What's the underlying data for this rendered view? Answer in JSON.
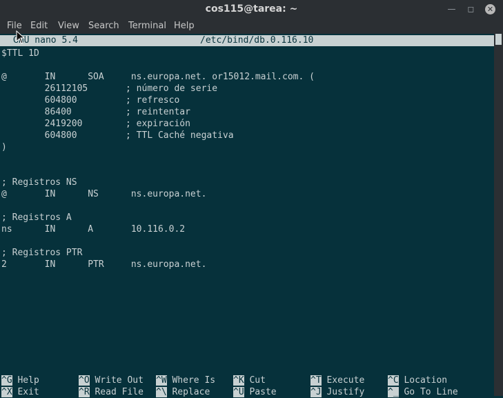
{
  "window": {
    "title": "cos115@tarea: ~"
  },
  "menu": {
    "file": "File",
    "edit": "Edit",
    "view": "View",
    "search": "Search",
    "terminal": "Terminal",
    "help": "Help"
  },
  "nano": {
    "version": "GNU nano 5.4",
    "filename": "/etc/bind/db.0.116.10"
  },
  "content": [
    "$TTL 1D",
    "",
    "@       IN      SOA     ns.europa.net. or15012.mail.com. (",
    "        26112105       ; número de serie",
    "        604800         ; refresco",
    "        86400          ; reintentar",
    "        2419200        ; expiración",
    "        604800         ; TTL Caché negativa",
    ")",
    "",
    "",
    "; Registros NS",
    "@       IN      NS      ns.europa.net.",
    "",
    "; Registros A",
    "ns      IN      A       10.116.0.2",
    "",
    "; Registros PTR",
    "2       IN      PTR     ns.europa.net."
  ],
  "shortcuts": [
    {
      "key": "^G",
      "label": "Help"
    },
    {
      "key": "^O",
      "label": "Write Out"
    },
    {
      "key": "^W",
      "label": "Where Is"
    },
    {
      "key": "^K",
      "label": "Cut"
    },
    {
      "key": "^T",
      "label": "Execute"
    },
    {
      "key": "^C",
      "label": "Location"
    },
    {
      "key": "^X",
      "label": "Exit"
    },
    {
      "key": "^R",
      "label": "Read File"
    },
    {
      "key": "^\\",
      "label": "Replace"
    },
    {
      "key": "^U",
      "label": "Paste"
    },
    {
      "key": "^J",
      "label": "Justify"
    },
    {
      "key": "^_",
      "label": "Go To Line"
    }
  ]
}
